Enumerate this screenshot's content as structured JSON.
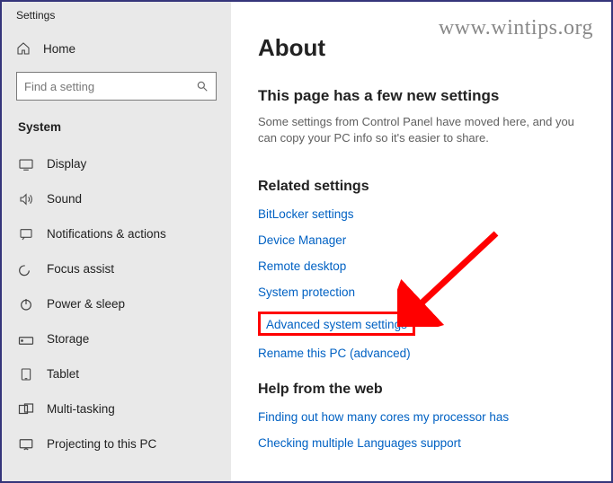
{
  "watermark": "www.wintips.org",
  "app_title": "Settings",
  "home_label": "Home",
  "search_placeholder": "Find a setting",
  "section_header": "System",
  "nav": [
    {
      "name": "display",
      "label": "Display"
    },
    {
      "name": "sound",
      "label": "Sound"
    },
    {
      "name": "notifications",
      "label": "Notifications & actions"
    },
    {
      "name": "focus-assist",
      "label": "Focus assist"
    },
    {
      "name": "power-sleep",
      "label": "Power & sleep"
    },
    {
      "name": "storage",
      "label": "Storage"
    },
    {
      "name": "tablet",
      "label": "Tablet"
    },
    {
      "name": "multitasking",
      "label": "Multi-tasking"
    },
    {
      "name": "projecting",
      "label": "Projecting to this PC"
    }
  ],
  "main": {
    "about": "About",
    "sub": "This page has a few new settings",
    "desc": "Some settings from Control Panel have moved here, and you can copy your PC info so it's easier to share.",
    "related_h": "Related settings",
    "links": [
      "BitLocker settings",
      "Device Manager",
      "Remote desktop",
      "System protection",
      "Advanced system settings",
      "Rename this PC (advanced)"
    ],
    "help_h": "Help from the web",
    "help_links": [
      "Finding out how many cores my processor has",
      "Checking multiple Languages support"
    ]
  }
}
